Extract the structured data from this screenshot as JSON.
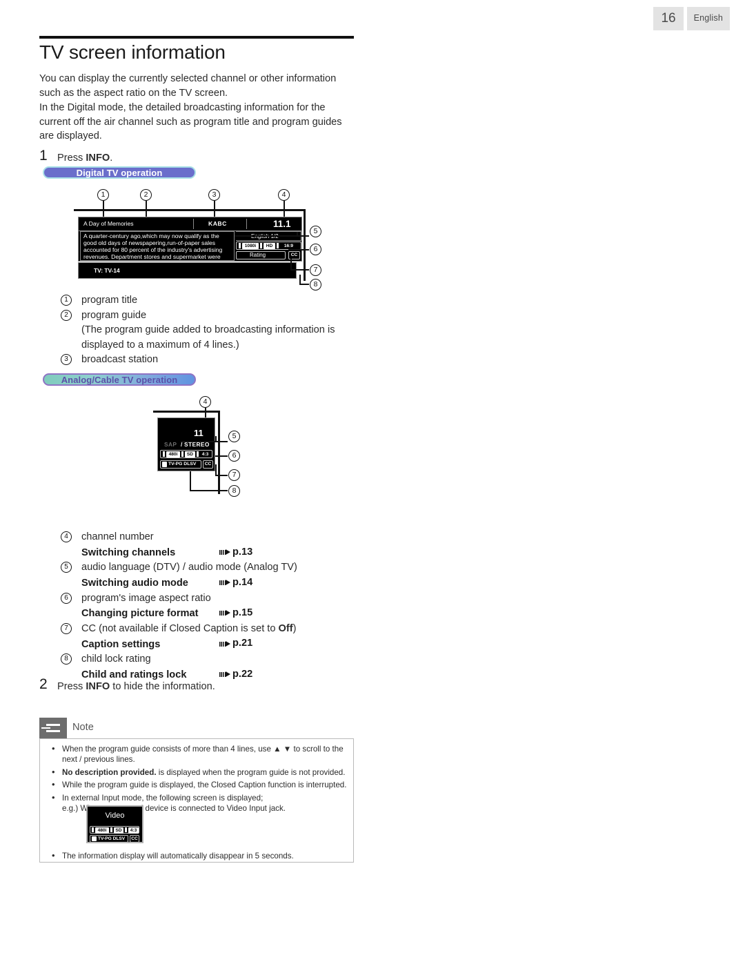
{
  "header": {
    "page_number": "16",
    "language": "English"
  },
  "title": "TV screen information",
  "intro": {
    "p1": "You can display the currently selected channel or other information such as the aspect ratio on the TV screen.",
    "p2": "In the Digital mode, the detailed broadcasting information for the current off the air channel such as program title and program guides are displayed."
  },
  "steps": {
    "one_num": "1",
    "one_pre": "Press ",
    "one_key": "INFO",
    "one_post": ".",
    "two_num": "2",
    "two_pre": "Press ",
    "two_key": "INFO",
    "two_post": " to hide the information."
  },
  "sections": {
    "digital_pill": "Digital TV operation",
    "analog_pill": "Analog/Cable TV operation"
  },
  "digital_osd": {
    "program_title": "A Day of Memories",
    "broadcast_station": "KABC",
    "channel_number": "11.1",
    "guide_lines": [
      "A quarter-century ago,which may now qualify as the",
      "good old days of newspapering,run-of-paper sales",
      "accounted for 80 percent of the industry's advertising",
      "revenues. Department stores and supermarket were"
    ],
    "audio_language": "English 1/2",
    "resolution_chip": "1080i",
    "quality_chip": "HD",
    "aspect_chip": "16:9",
    "rating_label": "Rating",
    "cc_chip": "CC",
    "child_lock": "TV: TV-14",
    "callouts": [
      "1",
      "2",
      "3",
      "4",
      "5",
      "6",
      "7",
      "8"
    ]
  },
  "analog_osd": {
    "channel_number": "11",
    "audio_sap": "SAP",
    "audio_sep": "/",
    "audio_stereo": "STEREO",
    "resolution_chip": "480i",
    "quality_chip": "SD",
    "aspect_chip": "4:3",
    "lock_chip": "TV-PG DLSV",
    "cc_chip": "CC",
    "callouts": [
      "4",
      "5",
      "6",
      "7",
      "8"
    ]
  },
  "legend_top": [
    {
      "num": "1",
      "text": "program title"
    },
    {
      "num": "2",
      "text": "program guide"
    },
    {
      "num": "",
      "text": "(The program guide added to broadcasting information is displayed to a maximum of 4 lines.)"
    },
    {
      "num": "3",
      "text": "broadcast station"
    }
  ],
  "legend_bottom": [
    {
      "num": "4",
      "desc": "channel number",
      "link": "Switching channels",
      "page": "p.13"
    },
    {
      "num": "5",
      "desc": "audio language (DTV) / audio mode (Analog TV)",
      "link": "Switching audio mode",
      "page": "p.14"
    },
    {
      "num": "6",
      "desc": "program's image aspect ratio",
      "link": "Changing picture format",
      "page": "p.15"
    },
    {
      "num": "7",
      "desc_pre": "CC (not available if Closed Caption is set to ",
      "desc_bold": "Off",
      "desc_post": ")",
      "link": "Caption settings",
      "page": "p.21"
    },
    {
      "num": "8",
      "desc": "child lock rating",
      "link": "Child and ratings lock",
      "page": "p.22"
    }
  ],
  "note": {
    "label": "Note",
    "items": [
      {
        "pre": "When the program guide consists of more than 4 lines, use ",
        "glyph": "▲ ▼",
        "post": " to scroll to the next / previous lines."
      },
      {
        "bold": "No description provided.",
        "post": " is displayed when the program guide is not provided."
      },
      {
        "pre": "While the program guide is displayed, the Closed Caption function is interrupted."
      },
      {
        "pre": "In external Input mode, the following screen is displayed;",
        "second": "e.g.) When an external device is connected to Video Input jack."
      },
      {
        "pre": "The information display will automatically disappear in 5 seconds."
      }
    ],
    "video_mock": {
      "label": "Video",
      "resolution_chip": "480i",
      "quality_chip": "SD",
      "aspect_chip": "4:3",
      "lock_chip": "TV-PG DLSV",
      "cc_chip": "CC"
    }
  }
}
